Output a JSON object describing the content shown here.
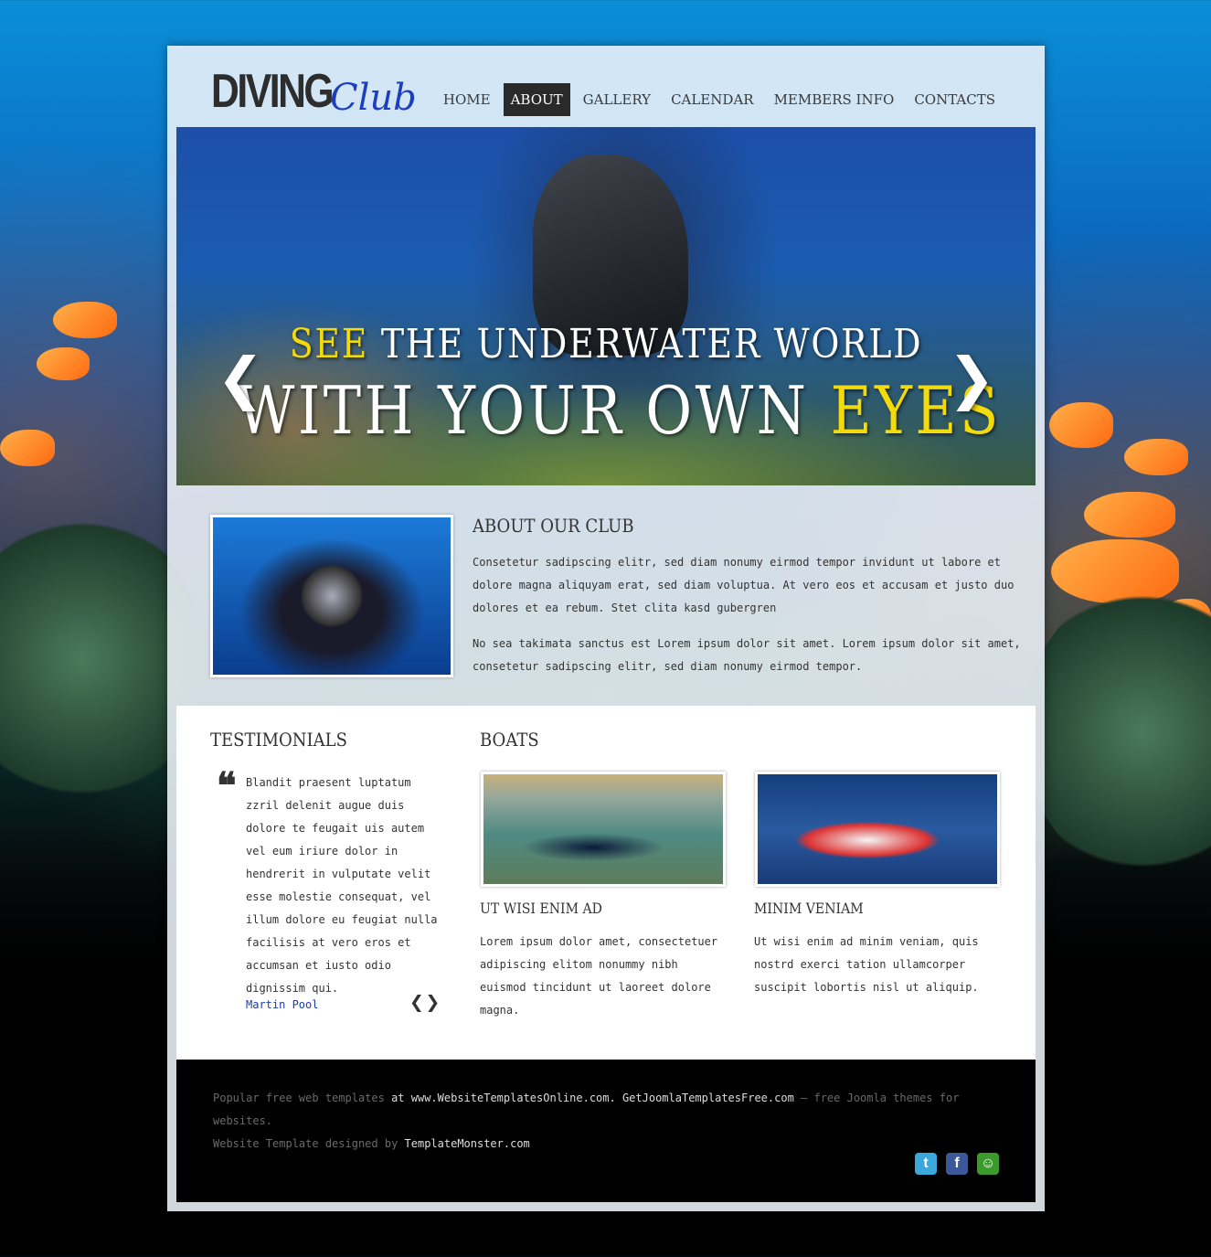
{
  "logo": {
    "word": "DIVING",
    "script": "Club"
  },
  "nav": [
    {
      "label": "HOME"
    },
    {
      "label": "ABOUT"
    },
    {
      "label": "GALLERY"
    },
    {
      "label": "CALENDAR"
    },
    {
      "label": "MEMBERS INFO"
    },
    {
      "label": "CONTACTS"
    }
  ],
  "hero": {
    "line1_highlight": "SEE",
    "line1_rest": " THE UNDERWATER WORLD",
    "line2_main": "WITH YOUR OWN ",
    "line2_highlight": "EYES",
    "prev": "❮",
    "next": "❯"
  },
  "about": {
    "title": "ABOUT OUR CLUB",
    "p1": "Consetetur sadipscing elitr, sed diam nonumy eirmod tempor invidunt ut labore et dolore magna aliquyam erat, sed diam voluptua. At vero eos et accusam et justo duo dolores et ea rebum. Stet clita kasd gubergren",
    "p2": "No sea takimata sanctus est Lorem ipsum dolor sit amet. Lorem ipsum dolor sit amet, consetetur sadipscing elitr, sed diam nonumy eirmod tempor."
  },
  "testimonials": {
    "title": "TESTIMONIALS",
    "quote_mark": "❝",
    "text": "Blandit praesent luptatum zzril delenit augue duis dolore te feugait uis autem vel eum iriure dolor in hendrerit in vulputate velit esse molestie consequat, vel illum dolore eu feugiat nulla facilisis at vero eros et accumsan et iusto odio dignissim qui.",
    "author": "Martin Pool",
    "arrows": "❮❯"
  },
  "boats": {
    "title": "BOATS",
    "items": [
      {
        "title": "UT WISI ENIM AD",
        "text": "Lorem ipsum dolor amet, consectetuer adipiscing elitom nonummy nibh euismod tincidunt ut laoreet dolore magna."
      },
      {
        "title": "MINIM VENIAM",
        "text": "Ut wisi enim ad minim veniam, quis nostrd exerci tation ullamcorper suscipit lobortis nisl ut aliquip."
      }
    ]
  },
  "footer": {
    "t1": "Popular free web templates",
    "t2": " at ",
    "link1": "www.WebsiteTemplatesOnline.com",
    "t3": ". ",
    "link2": "GetJoomlaTemplatesFree.com",
    "t4": " – free Joomla themes for websites.",
    "t5": "Website Template designed by ",
    "link3": "TemplateMonster.com",
    "social": [
      {
        "icon": "twitter-icon",
        "glyph": "t",
        "color": "#3aa7dd"
      },
      {
        "icon": "facebook-icon",
        "glyph": "f",
        "color": "#3b5998"
      },
      {
        "icon": "chat-icon",
        "glyph": "☺",
        "color": "#3a9a2a"
      }
    ]
  },
  "colors": {
    "accent_yellow": "#f3da0b",
    "nav_active_bg": "#2a2a2a",
    "link_blue": "#1e3da8"
  }
}
